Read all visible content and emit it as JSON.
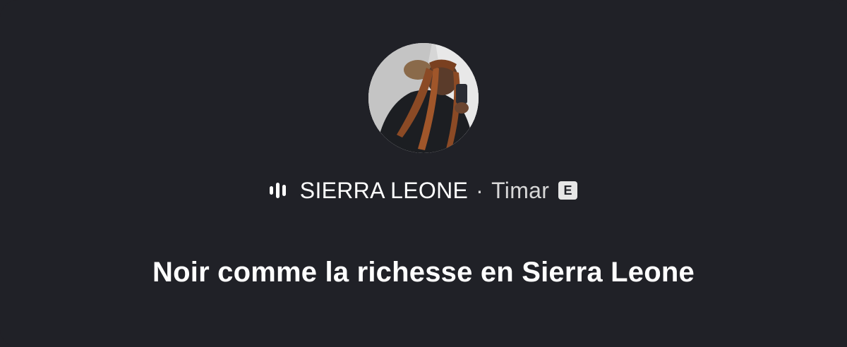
{
  "colors": {
    "background": "#202127",
    "text_primary": "#ffffff",
    "text_secondary": "#d8d8d8",
    "badge_bg": "#e6e6e6"
  },
  "header": {
    "avatar_icon": "profile-photo",
    "stream_icon": "audio-waveform-icon",
    "artist": "SIERRA LEONE",
    "separator": "·",
    "album": "Timar",
    "explicit_badge": "E"
  },
  "track": {
    "title": "Noir comme la richesse en Sierra Leone"
  }
}
